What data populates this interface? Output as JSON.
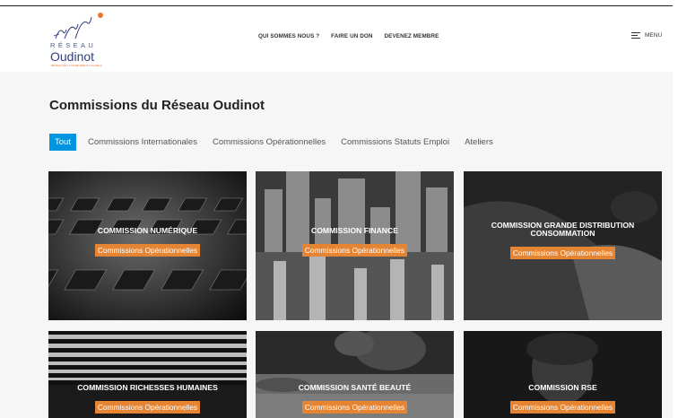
{
  "header": {
    "logo": {
      "reseau": "RÉSEAU",
      "name": "Oudinot",
      "tagline": "RÉSEAU DE L'OUTRE-MER ET AU-DELÀ"
    },
    "nav": [
      "QUI SOMMES NOUS ?",
      "FAIRE UN DON",
      "DEVENEZ MEMBRE"
    ],
    "menu_label": "MENU"
  },
  "main": {
    "title": "Commissions du Réseau Oudinot",
    "filters": [
      "Tout",
      "Commissions Internationales",
      "Commissions Opérationnelles",
      "Commissions Statuts Emploi",
      "Ateliers"
    ],
    "active_filter": "Tout"
  },
  "cards": [
    {
      "title": "COMMISSION NUMÉRIQUE",
      "badge": "Commissions Opérationnelles",
      "image": "keyboard"
    },
    {
      "title": "COMMISSION FINANCE",
      "badge": "Commissions Opérationnelles",
      "image": "city-skyline"
    },
    {
      "title": "COMMISSION GRANDE DISTRIBUTION CONSOMMATION",
      "badge": "Commissions Opérationnelles",
      "image": "person-sitting"
    },
    {
      "title": "COMMISSION RICHESSES HUMAINES",
      "badge": "Commissions Opérationnelles",
      "image": "window-blinds"
    },
    {
      "title": "COMMISSION SANTÉ BEAUTÉ",
      "badge": "Commissions Opérationnelles",
      "image": "plants-water"
    },
    {
      "title": "COMMISSION RSE",
      "badge": "Commissions Opérationnelles",
      "image": "portrait"
    }
  ],
  "colors": {
    "accent_blue": "#0095e0",
    "badge_orange": "#e58533",
    "logo_blue": "#2d3e7a",
    "logo_orange": "#e8762c"
  }
}
